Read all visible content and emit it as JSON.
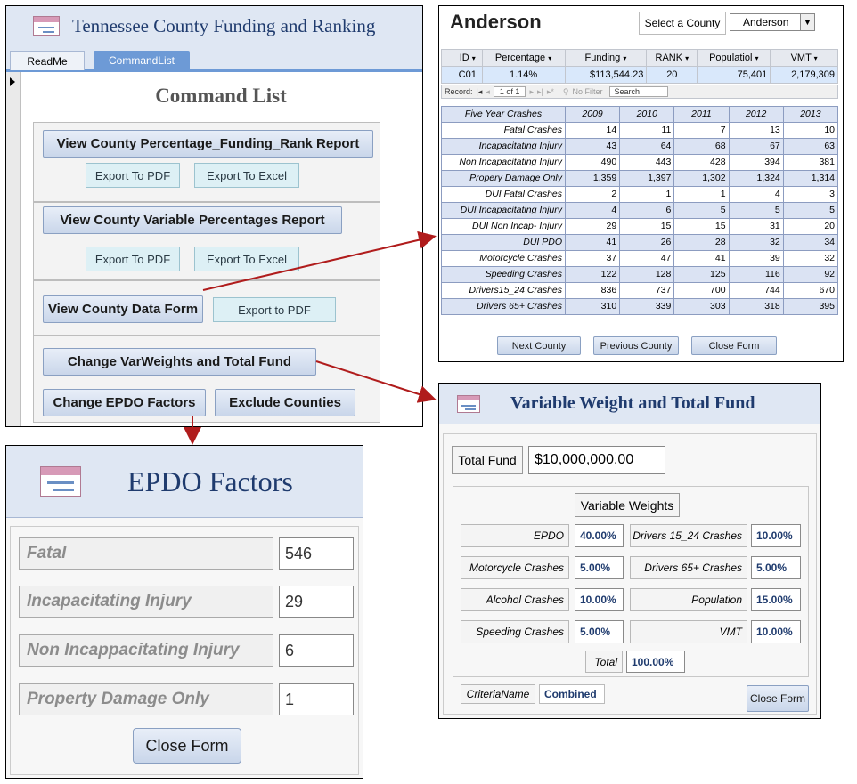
{
  "command_window": {
    "title": "Tennessee County Funding and Ranking",
    "tabs": [
      {
        "label": "ReadMe"
      },
      {
        "label": "CommandList"
      }
    ],
    "heading": "Command List",
    "sections": {
      "s1": {
        "main": "View County Percentage_Funding_Rank Report",
        "pdf": "Export To PDF",
        "excel": "Export To Excel"
      },
      "s2": {
        "main": "View County Variable Percentages Report",
        "pdf": "Export To PDF",
        "excel": "Export To Excel"
      },
      "s3": {
        "main": "View County Data Form",
        "pdf": "Export to PDF"
      },
      "s4": {
        "weights": "Change VarWeights and Total Fund",
        "epdo": "Change EPDO Factors",
        "exclude": "Exclude Counties"
      }
    }
  },
  "county_form": {
    "county_name": "Anderson",
    "select_label": "Select a County",
    "select_value": "Anderson",
    "record": {
      "headers": [
        "ID",
        "Percentage",
        "Funding",
        "RANK",
        "Populatiol",
        "VMT"
      ],
      "values": [
        "C01",
        "1.14%",
        "$113,544.23",
        "20",
        "75,401",
        "2,179,309"
      ]
    },
    "nav": {
      "record_label": "Record:",
      "position": "1 of 1",
      "filter": "No Filter",
      "search": "Search"
    },
    "crash_table": {
      "header_label": "Five Year Crashes",
      "years": [
        "2009",
        "2010",
        "2011",
        "2012",
        "2013"
      ],
      "rows": [
        {
          "label": "Fatal Crashes",
          "values": [
            "14",
            "11",
            "7",
            "13",
            "10"
          ]
        },
        {
          "label": "Incapacitating Injury",
          "values": [
            "43",
            "64",
            "68",
            "67",
            "63"
          ]
        },
        {
          "label": "Non Incapacitating Injury",
          "values": [
            "490",
            "443",
            "428",
            "394",
            "381"
          ]
        },
        {
          "label": "Propery Damage Only",
          "values": [
            "1,359",
            "1,397",
            "1,302",
            "1,324",
            "1,314"
          ]
        },
        {
          "label": "DUI Fatal Crashes",
          "values": [
            "2",
            "1",
            "1",
            "4",
            "3"
          ]
        },
        {
          "label": "DUI Incapacitating Injury",
          "values": [
            "4",
            "6",
            "5",
            "5",
            "5"
          ]
        },
        {
          "label": "DUI Non Incap- Injury",
          "values": [
            "29",
            "15",
            "15",
            "31",
            "20"
          ]
        },
        {
          "label": "DUI PDO",
          "values": [
            "41",
            "26",
            "28",
            "32",
            "34"
          ]
        },
        {
          "label": "Motorcycle Crashes",
          "values": [
            "37",
            "47",
            "41",
            "39",
            "32"
          ]
        },
        {
          "label": "Speeding Crashes",
          "values": [
            "122",
            "128",
            "125",
            "116",
            "92"
          ]
        },
        {
          "label": "Drivers15_24 Crashes",
          "values": [
            "836",
            "737",
            "700",
            "744",
            "670"
          ]
        },
        {
          "label": "Drivers 65+ Crashes",
          "values": [
            "310",
            "339",
            "303",
            "318",
            "395"
          ]
        }
      ]
    },
    "buttons": {
      "next": "Next County",
      "previous": "Previous County",
      "close": "Close Form"
    }
  },
  "weights_form": {
    "title": "Variable Weight and Total Fund",
    "total_fund_label": "Total Fund",
    "total_fund_value": "$10,000,000.00",
    "weights_heading": "Variable Weights",
    "weights": [
      {
        "label": "EPDO",
        "value": "40.00%"
      },
      {
        "label": "Drivers 15_24 Crashes",
        "value": "10.00%"
      },
      {
        "label": "Motorcycle Crashes",
        "value": "5.00%"
      },
      {
        "label": "Drivers 65+ Crashes",
        "value": "5.00%"
      },
      {
        "label": "Alcohol Crashes",
        "value": "10.00%"
      },
      {
        "label": "Population",
        "value": "15.00%"
      },
      {
        "label": "Speeding Crashes",
        "value": "5.00%"
      },
      {
        "label": "VMT",
        "value": "10.00%"
      }
    ],
    "total_label": "Total",
    "total_value": "100.00%",
    "criteria_label": "CriteriaName",
    "criteria_value": "Combined",
    "close": "Close Form"
  },
  "epdo_form": {
    "title": "EPDO Factors",
    "factors": [
      {
        "label": "Fatal",
        "value": "546"
      },
      {
        "label": "Incapacitating Injury",
        "value": "29"
      },
      {
        "label": "Non Incappacitating Injury",
        "value": "6"
      },
      {
        "label": "Property Damage Only",
        "value": "1"
      }
    ],
    "close": "Close Form"
  },
  "colors": {
    "arrow": "#b01c1c",
    "title_blue": "#1f3b6e",
    "tab_active": "#6d9ad6"
  }
}
